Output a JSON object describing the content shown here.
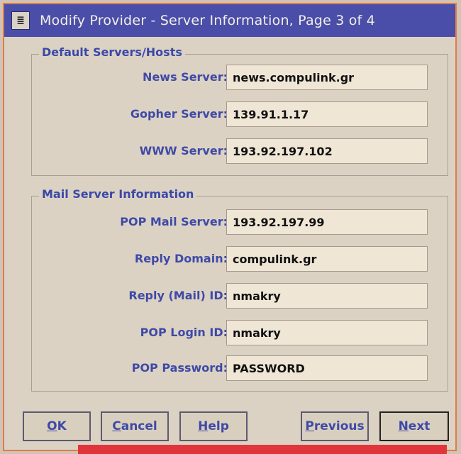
{
  "window": {
    "title": "Modify Provider - Server Information, Page 3 of 4",
    "sysmenu_glyph": "≣"
  },
  "default_servers": {
    "group_label": "Default Servers/Hosts",
    "news": {
      "label": "News Server:",
      "value": "news.compulink.gr"
    },
    "gopher": {
      "label": "Gopher Server:",
      "value": "139.91.1.17"
    },
    "www": {
      "label": "WWW Server:",
      "value": "193.92.197.102"
    }
  },
  "mail_server": {
    "group_label": "Mail Server Information",
    "pop_server": {
      "label": "POP Mail Server:",
      "value": "193.92.197.99"
    },
    "reply_domain": {
      "label": "Reply Domain:",
      "value": "compulink.gr"
    },
    "reply_id": {
      "label": "Reply (Mail) ID:",
      "value": "nmakry"
    },
    "pop_login": {
      "label": "POP Login ID:",
      "value": "nmakry"
    },
    "pop_password": {
      "label": "POP Password:",
      "value": "PASSWORD"
    }
  },
  "buttons": {
    "ok": {
      "mnemonic": "O",
      "rest": "K"
    },
    "cancel": {
      "mnemonic": "C",
      "rest": "ancel"
    },
    "help": {
      "mnemonic": "H",
      "rest": "elp"
    },
    "previous": {
      "mnemonic": "P",
      "rest": "revious"
    },
    "next": {
      "mnemonic": "N",
      "rest": "ext"
    }
  },
  "colors": {
    "titlebar": "#4a4ea8",
    "label_text": "#3e4aa6",
    "window_bg": "#dcd2c4",
    "field_bg": "#efe6d6"
  }
}
